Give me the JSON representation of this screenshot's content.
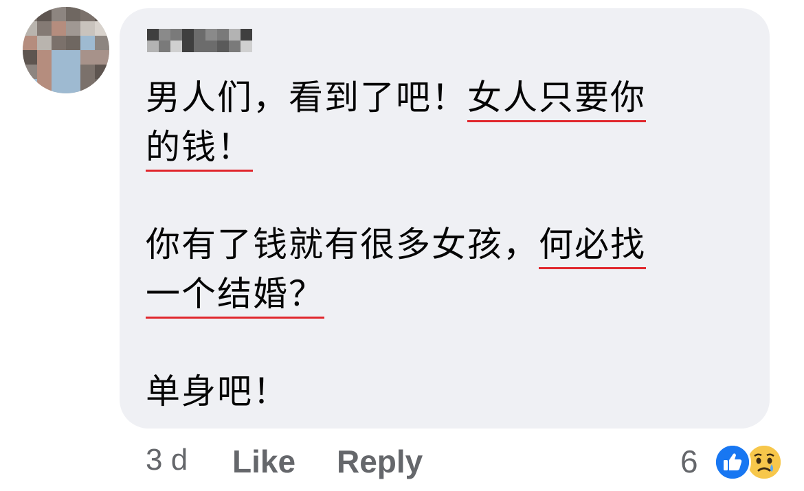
{
  "comment": {
    "lines": [
      {
        "segments": [
          {
            "text": "男人们，看到了吧！",
            "underline": false
          },
          {
            "text": "女人只要你",
            "underline": true
          }
        ]
      },
      {
        "segments": [
          {
            "text": "的钱！",
            "underline": true
          }
        ]
      },
      {
        "segments": [
          {
            "text": "你有了钱就有很多女孩，",
            "underline": false
          },
          {
            "text": "何必找",
            "underline": true
          }
        ]
      },
      {
        "segments": [
          {
            "text": "一个结婚？",
            "underline": true
          }
        ]
      },
      {
        "segments": [
          {
            "text": "单身吧！",
            "underline": false
          }
        ]
      }
    ]
  },
  "footer": {
    "time": "3 d",
    "like_label": "Like",
    "reply_label": "Reply",
    "reaction_count": "6",
    "reactions": [
      "like-icon",
      "sad-icon"
    ]
  },
  "colors": {
    "bubble": "#eff0f4",
    "text": "#050505",
    "meta": "#65676b",
    "underline": "#e0262c",
    "like_blue": "#1877f2",
    "sad_yellow": "#f7c74b"
  }
}
